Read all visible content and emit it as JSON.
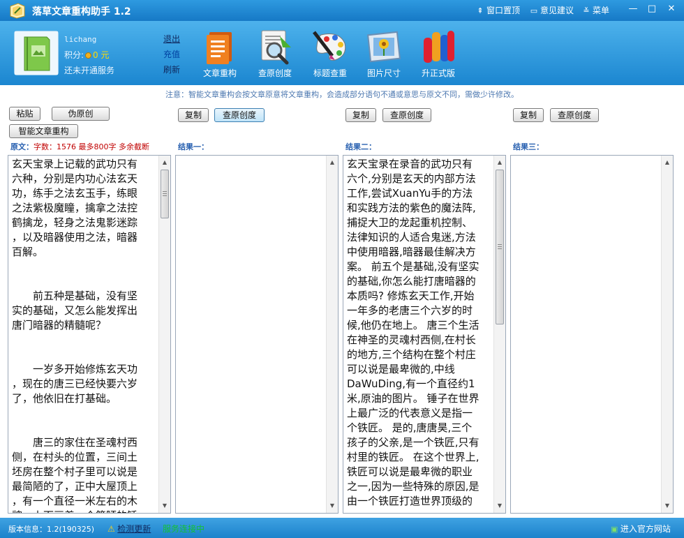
{
  "app": {
    "title": "落草文章重构助手 1.2",
    "top_links": {
      "pin": "窗口置顶",
      "feedback": "意见建议",
      "menu": "菜单"
    },
    "window_controls": {
      "minimize": "—",
      "maximize": "□",
      "close": "✕"
    }
  },
  "user": {
    "name": "lichang",
    "points_label": "积分:",
    "points_value": "0",
    "points_unit": "元",
    "service_status": "还未开通服务",
    "links": {
      "logout": "退出",
      "recharge": "充值",
      "refresh": "刷新"
    }
  },
  "tools": [
    {
      "label": "文章重构",
      "icon": "document-rewrite-icon"
    },
    {
      "label": "查原创度",
      "icon": "magnifier-check-icon"
    },
    {
      "label": "标题查重",
      "icon": "paint-palette-icon"
    },
    {
      "label": "图片尺寸",
      "icon": "picture-frame-icon"
    },
    {
      "label": "升正式版",
      "icon": "upgrade-bars-icon"
    }
  ],
  "notice": "注意：智能文章重构会按文章原意将文章重构，会造成部分语句不通或意思与原文不同，需做少许修改。",
  "source": {
    "buttons": {
      "paste": "粘贴",
      "pseudo": "伪原创",
      "smart": "智能文章重构"
    },
    "label": "原文：",
    "stats": "字数：1576 最多800字 多余截断",
    "text": "玄天宝录上记载的武功只有\n六种，分别是内功心法玄天\n功，练手之法玄玉手，练眼\n之法紫极魔瞳，擒拿之法控\n鹤擒龙，轻身之法鬼影迷踪\n，以及暗器使用之法，暗器\n百解。\n\n\n　　前五种是基础，没有坚\n实的基础，又怎么能发挥出\n唐门暗器的精髓呢？\n\n\n　　一岁多开始修炼玄天功\n，现在的唐三已经快要六岁\n了，他依旧在打基础。\n\n\n　　唐三的家住在圣魂村西\n侧，在村头的位置，三间土\n坯房在整个村子里可以说是\n最简陋的了，正中大屋顶上\n，有一个直径一米左右的木\n牌，上面画着一个简陋的锤\n子。锤子在这个世界最广泛\n的代表意义指的是铁匠。"
  },
  "result_buttons": {
    "copy": "复制",
    "check": "查原创度"
  },
  "results": [
    {
      "label": "结果一：",
      "text": ""
    },
    {
      "label": "结果二：",
      "text": "玄天宝录在录音的武功只有\n六个,分别是玄天的内部方法\n工作,尝试XuanYu手的方法\n和实践方法的紫色的魔法阵,\n捕捉大卫的龙起重机控制、\n法律知识的人适合鬼迷,方法\n中使用暗器,暗器最佳解决方\n案。 前五个是基础,没有坚实\n的基础,你怎么能打唐暗器的\n本质吗? 修炼玄天工作,开始\n一年多的老唐三个六岁的时\n候,他仍在地上。 唐三个生活\n在神圣的灵魂村西侧,在村长\n的地方,三个结构在整个村庄\n可以说是最卑微的,中线\nDaWuDing,有一个直径约1\n米,原油的图片。 锤子在世界\n上最广泛的代表意义是指一\n个铁匠。 是的,唐唐昊,三个\n孩子的父亲,是一个铁匠,只有\n村里的铁匠。 在这个世界上,\n铁匠可以说是最卑微的职业\n之一,因为一些特殊的原因,是\n由一个铁匠打造世界顶级的"
    },
    {
      "label": "结果三：",
      "text": ""
    }
  ],
  "status": {
    "version": "版本信息：1.2(190325)",
    "update": "检测更新",
    "connection": "服务连接中",
    "website": "进入官方网站"
  },
  "colors": {
    "titlebar": "#1f86d2",
    "toolbar": "#3aa3e4",
    "label_blue": "#2860b0",
    "stats_red": "#c00000",
    "connected_green": "#14c034"
  }
}
